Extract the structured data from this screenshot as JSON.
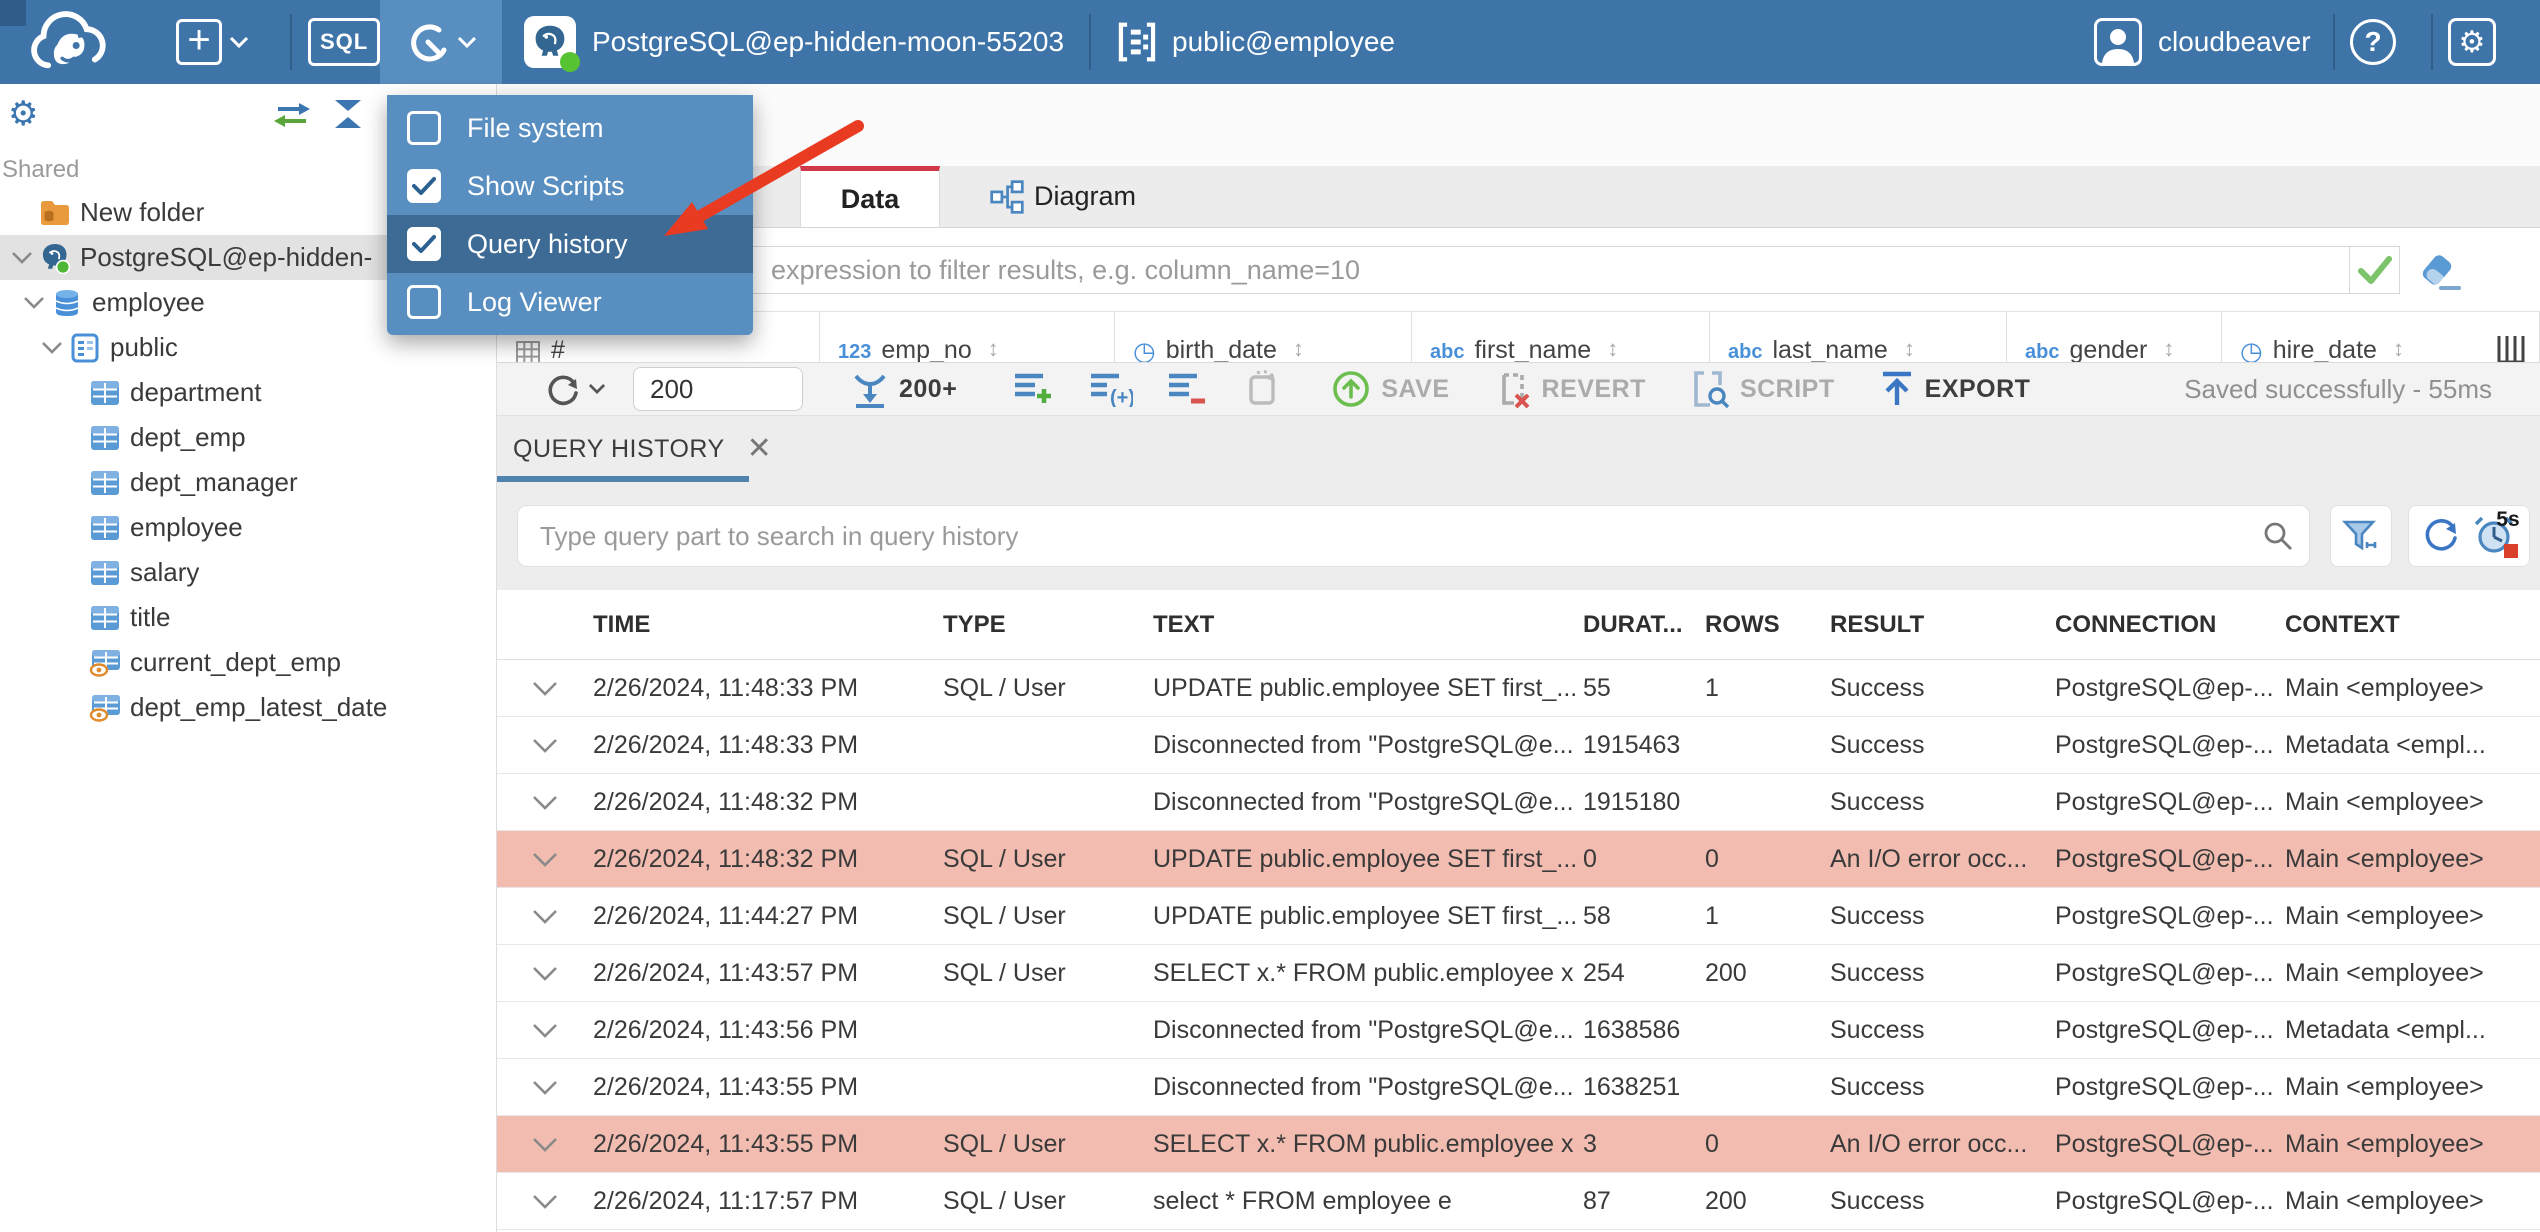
{
  "topbar": {
    "sql_label": "SQL",
    "connection_name": "PostgreSQL@ep-hidden-moon-55203",
    "schema_path": "public@employee",
    "username": "cloudbeaver",
    "help_label": "?"
  },
  "tools_menu": {
    "items": [
      {
        "label": "File system",
        "checked": false,
        "highlighted": false
      },
      {
        "label": "Show Scripts",
        "checked": true,
        "highlighted": false
      },
      {
        "label": "Query history",
        "checked": true,
        "highlighted": true
      },
      {
        "label": "Log Viewer",
        "checked": false,
        "highlighted": false
      }
    ]
  },
  "sidebar": {
    "group_label": "Shared",
    "tree": [
      {
        "label": "New folder",
        "icon": "folder",
        "level": 0,
        "chevron": false
      },
      {
        "label": "PostgreSQL@ep-hidden-",
        "icon": "postgres",
        "level": 0,
        "chevron": true,
        "selected": true
      },
      {
        "label": "employee",
        "icon": "database",
        "level": 1,
        "chevron": true
      },
      {
        "label": "public",
        "icon": "schema",
        "level": 2,
        "chevron": true
      },
      {
        "label": "department",
        "icon": "table",
        "level": 3,
        "chevron": false
      },
      {
        "label": "dept_emp",
        "icon": "table",
        "level": 3,
        "chevron": false
      },
      {
        "label": "dept_manager",
        "icon": "table",
        "level": 3,
        "chevron": false
      },
      {
        "label": "employee",
        "icon": "table",
        "level": 3,
        "chevron": false
      },
      {
        "label": "salary",
        "icon": "table",
        "level": 3,
        "chevron": false
      },
      {
        "label": "title",
        "icon": "table",
        "level": 3,
        "chevron": false
      },
      {
        "label": "current_dept_emp",
        "icon": "view",
        "level": 3,
        "chevron": false
      },
      {
        "label": "dept_emp_latest_date",
        "icon": "view",
        "level": 3,
        "chevron": false
      }
    ]
  },
  "editor": {
    "tabs": [
      {
        "label": "Data",
        "active": true
      },
      {
        "label": "Diagram",
        "active": false
      }
    ],
    "filter_placeholder": "expression to filter results, e.g. column_name=10",
    "row_number_header": "#",
    "grid_columns": [
      {
        "tag": "123",
        "name": "emp_no"
      },
      {
        "tag": "clock",
        "name": "birth_date"
      },
      {
        "tag": "abc",
        "name": "first_name"
      },
      {
        "tag": "abc",
        "name": "last_name"
      },
      {
        "tag": "abc",
        "name": "gender"
      },
      {
        "tag": "clock",
        "name": "hire_date"
      }
    ],
    "toolbar": {
      "row_limit": "200",
      "load_more_label": "200+",
      "save_label": "SAVE",
      "revert_label": "REVERT",
      "script_label": "SCRIPT",
      "export_label": "EXPORT",
      "status": "Saved successfully - 55ms"
    }
  },
  "query_history": {
    "tab_label": "QUERY HISTORY",
    "search_placeholder": "Type query part to search in query history",
    "auto_refresh_interval": "5s",
    "columns": [
      "TIME",
      "TYPE",
      "TEXT",
      "DURAT...",
      "ROWS",
      "RESULT",
      "CONNECTION",
      "CONTEXT"
    ],
    "rows": [
      {
        "time": "2/26/2024, 11:48:33 PM",
        "type": "SQL / User",
        "text": "UPDATE public.employee SET first_...",
        "duration": "55",
        "rows": "1",
        "result": "Success",
        "connection": "PostgreSQL@ep-...",
        "context": "Main <employee>",
        "error": false
      },
      {
        "time": "2/26/2024, 11:48:33 PM",
        "type": "",
        "text": "Disconnected from \"PostgreSQL@e...",
        "duration": "1915463",
        "rows": "",
        "result": "Success",
        "connection": "PostgreSQL@ep-...",
        "context": "Metadata <empl...",
        "error": false
      },
      {
        "time": "2/26/2024, 11:48:32 PM",
        "type": "",
        "text": "Disconnected from \"PostgreSQL@e...",
        "duration": "1915180",
        "rows": "",
        "result": "Success",
        "connection": "PostgreSQL@ep-...",
        "context": "Main <employee>",
        "error": false
      },
      {
        "time": "2/26/2024, 11:48:32 PM",
        "type": "SQL / User",
        "text": "UPDATE public.employee SET first_...",
        "duration": "0",
        "rows": "0",
        "result": "An I/O error occ...",
        "connection": "PostgreSQL@ep-...",
        "context": "Main <employee>",
        "error": true
      },
      {
        "time": "2/26/2024, 11:44:27 PM",
        "type": "SQL / User",
        "text": "UPDATE public.employee SET first_...",
        "duration": "58",
        "rows": "1",
        "result": "Success",
        "connection": "PostgreSQL@ep-...",
        "context": "Main <employee>",
        "error": false
      },
      {
        "time": "2/26/2024, 11:43:57 PM",
        "type": "SQL / User",
        "text": "SELECT x.* FROM public.employee x",
        "duration": "254",
        "rows": "200",
        "result": "Success",
        "connection": "PostgreSQL@ep-...",
        "context": "Main <employee>",
        "error": false
      },
      {
        "time": "2/26/2024, 11:43:56 PM",
        "type": "",
        "text": "Disconnected from \"PostgreSQL@e...",
        "duration": "1638586",
        "rows": "",
        "result": "Success",
        "connection": "PostgreSQL@ep-...",
        "context": "Metadata <empl...",
        "error": false
      },
      {
        "time": "2/26/2024, 11:43:55 PM",
        "type": "",
        "text": "Disconnected from \"PostgreSQL@e...",
        "duration": "1638251",
        "rows": "",
        "result": "Success",
        "connection": "PostgreSQL@ep-...",
        "context": "Main <employee>",
        "error": false
      },
      {
        "time": "2/26/2024, 11:43:55 PM",
        "type": "SQL / User",
        "text": "SELECT x.* FROM public.employee x",
        "duration": "3",
        "rows": "0",
        "result": "An I/O error occ...",
        "connection": "PostgreSQL@ep-...",
        "context": "Main <employee>",
        "error": true
      },
      {
        "time": "2/26/2024, 11:17:57 PM",
        "type": "SQL / User",
        "text": "select * FROM employee e",
        "duration": "87",
        "rows": "200",
        "result": "Success",
        "connection": "PostgreSQL@ep-...",
        "context": "Main <employee>",
        "error": false
      }
    ]
  },
  "colors": {
    "topbar_blue": "#3e74a8",
    "tools_open_blue": "#588ec0",
    "menu_highlight": "#3d6b96",
    "tab_accent_red": "#d0394a",
    "arrow_red": "#e93b22",
    "error_row_pink": "#f2bcb0",
    "icon_blue": "#4a86c0",
    "status_green": "#57c232",
    "qh_underline_blue": "#4f83ad"
  }
}
